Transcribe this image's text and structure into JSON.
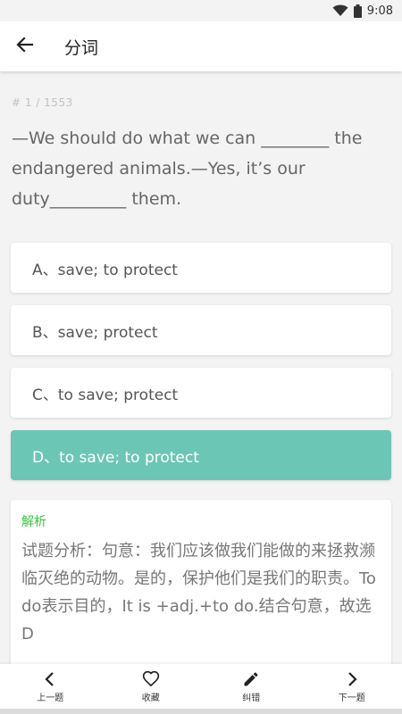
{
  "status_bar": {
    "time": "9:08"
  },
  "header": {
    "title": "分词"
  },
  "question": {
    "index": "# 1 / 1553",
    "text": "—We should do what we can ________ the endangered animals.—Yes, it’s our duty_________ them."
  },
  "options": [
    {
      "label": "A、save; to protect",
      "selected": false
    },
    {
      "label": "B、save; protect",
      "selected": false
    },
    {
      "label": "C、to save; protect",
      "selected": false
    },
    {
      "label": "D、to save; to protect",
      "selected": true
    }
  ],
  "analysis": {
    "title": "解析",
    "body": "试题分析：句意：我们应该做我们能做的来拯救濒临灭绝的动物。是的，保护他们是我们的职责。To do表示目的，It is +adj.+to do.结合句意，故选D"
  },
  "bottom_nav": {
    "prev": "上一题",
    "favorite": "收藏",
    "correct": "纠错",
    "next": "下一题"
  },
  "colors": {
    "selected_option": "#6cc6b6",
    "analysis_title": "#39c33f"
  },
  "icons": {
    "status": [
      "wifi-icon",
      "battery-icon"
    ],
    "header": "arrow-back-icon",
    "nav": [
      "chevron-left-icon",
      "heart-outline-icon",
      "pencil-icon",
      "chevron-right-icon"
    ]
  }
}
